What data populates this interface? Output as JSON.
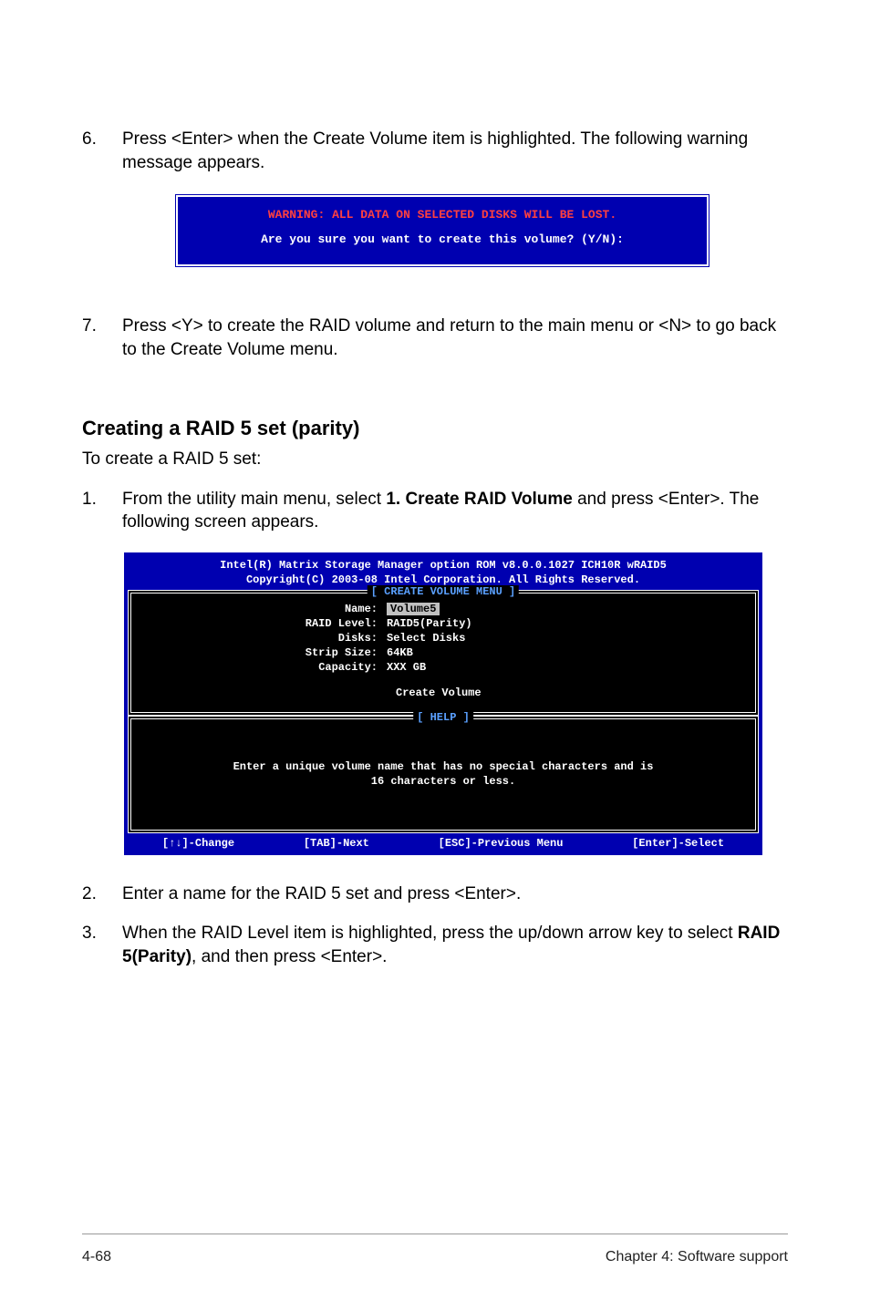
{
  "steps": {
    "s6_num": "6.",
    "s6_text_a": "Press <Enter> when the Create Volume item is highlighted. The following warning message appears.",
    "s7_num": "7.",
    "s7_text": "Press <Y> to create the RAID volume and return to the main menu or <N> to go back to the Create Volume menu.",
    "s1_num": "1.",
    "s1_text_a": "From the utility main menu, select ",
    "s1_text_bold": "1. Create RAID Volume",
    "s1_text_b": " and press <Enter>. The following screen appears.",
    "s2_num": "2.",
    "s2_text": "Enter a name for the RAID 5 set and press <Enter>.",
    "s3_num": "3.",
    "s3_text_a": "When the RAID Level item is highlighted, press the up/down arrow key to select ",
    "s3_text_bold": "RAID 5(Parity)",
    "s3_text_b": ", and then press <Enter>."
  },
  "warning": {
    "line1": "WARNING: ALL DATA ON SELECTED DISKS WILL BE LOST.",
    "line2": "Are you sure you want to create this volume? (Y/N):"
  },
  "subheading": "Creating a RAID 5 set (parity)",
  "intro": "To create a RAID 5 set:",
  "bios": {
    "header1": "Intel(R) Matrix Storage Manager option ROM v8.0.0.1027 ICH10R wRAID5",
    "header2": "Copyright(C) 2003-08 Intel Corporation. All Rights Reserved.",
    "create_title": "[ CREATE VOLUME MENU ]",
    "help_title": "[ HELP ]",
    "rows": {
      "name_label": "Name:",
      "name_val": "Volume5",
      "raid_label": "RAID Level:",
      "raid_val": "RAID5(Parity)",
      "disks_label": "Disks:",
      "disks_val": "Select Disks",
      "strip_label": "Strip Size:",
      "strip_val": "64KB",
      "cap_label": "Capacity:",
      "cap_val": "XXX   GB"
    },
    "action": "Create Volume",
    "help_text1": "Enter a unique volume name that has no special characters and is",
    "help_text2": "16 characters or less.",
    "footer": {
      "change": "[↑↓]-Change",
      "next": "[TAB]-Next",
      "prev": "[ESC]-Previous Menu",
      "select": "[Enter]-Select"
    }
  },
  "footer": {
    "left": "4-68",
    "right": "Chapter 4: Software support"
  }
}
